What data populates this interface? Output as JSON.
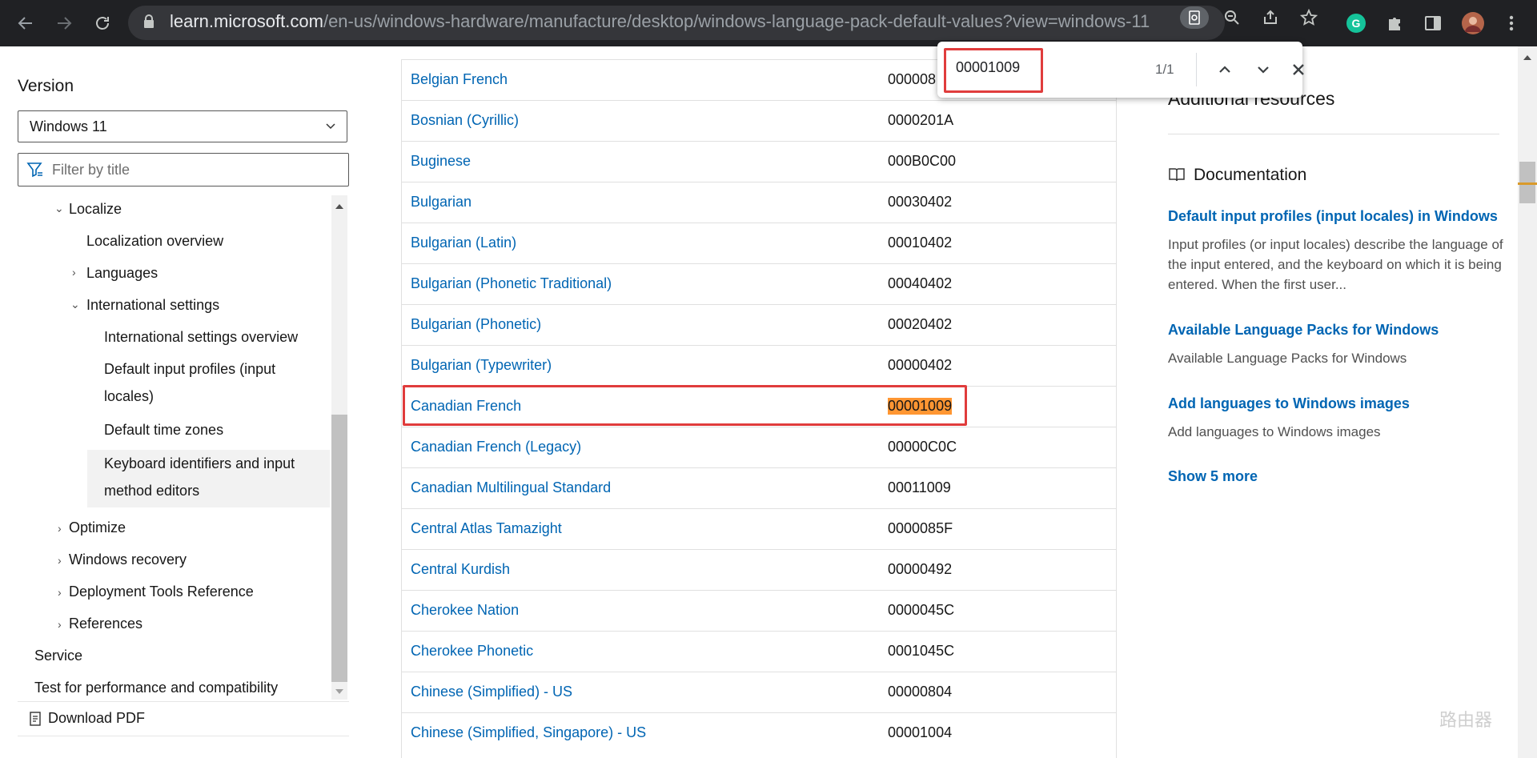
{
  "browser": {
    "url_host": "learn.microsoft.com",
    "url_path": "/en-us/windows-hardware/manufacture/desktop/windows-language-pack-default-values?view=windows-11",
    "find": {
      "query": "00001009",
      "count": "1/1"
    }
  },
  "sidebar": {
    "version_label": "Version",
    "version_value": "Windows 11",
    "filter_placeholder": "Filter by title",
    "items": [
      {
        "label": "Localize"
      },
      {
        "label": "Localization overview"
      },
      {
        "label": "Languages"
      },
      {
        "label": "International settings"
      },
      {
        "label": "International settings overview"
      },
      {
        "label": "Default input profiles (input"
      },
      {
        "label": "locales)"
      },
      {
        "label": "Default time zones"
      },
      {
        "label": "Keyboard identifiers and input"
      },
      {
        "label": "method editors"
      },
      {
        "label": "Optimize"
      },
      {
        "label": "Windows recovery"
      },
      {
        "label": "Deployment Tools Reference"
      },
      {
        "label": "References"
      },
      {
        "label": "Service"
      },
      {
        "label": "Test for performance and compatibility"
      }
    ],
    "download_pdf": "Download PDF"
  },
  "table": {
    "rows": [
      {
        "name": "Belgian French",
        "code": "000008"
      },
      {
        "name": "Bosnian (Cyrillic)",
        "code": "0000201A"
      },
      {
        "name": "Buginese",
        "code": "000B0C00"
      },
      {
        "name": "Bulgarian",
        "code": "00030402"
      },
      {
        "name": "Bulgarian (Latin)",
        "code": "00010402"
      },
      {
        "name": "Bulgarian (Phonetic Traditional)",
        "code": "00040402"
      },
      {
        "name": "Bulgarian (Phonetic)",
        "code": "00020402"
      },
      {
        "name": "Bulgarian (Typewriter)",
        "code": "00000402"
      },
      {
        "name": "Canadian French",
        "code": "00001009"
      },
      {
        "name": "Canadian French (Legacy)",
        "code": "00000C0C"
      },
      {
        "name": "Canadian Multilingual Standard",
        "code": "00011009"
      },
      {
        "name": "Central Atlas Tamazight",
        "code": "0000085F"
      },
      {
        "name": "Central Kurdish",
        "code": "00000492"
      },
      {
        "name": "Cherokee Nation",
        "code": "0000045C"
      },
      {
        "name": "Cherokee Phonetic",
        "code": "0001045C"
      },
      {
        "name": "Chinese (Simplified) - US",
        "code": "00000804"
      },
      {
        "name": "Chinese (Simplified, Singapore) - US",
        "code": "00001004"
      }
    ]
  },
  "right": {
    "additional_resources": "Additional resources",
    "documentation": "Documentation",
    "links": [
      {
        "title": "Default input profiles (input locales) in Windows",
        "desc": "Input profiles (or input locales) describe the language of the input entered, and the keyboard on which it is being entered. When the first user..."
      },
      {
        "title": "Available Language Packs for Windows",
        "desc": "Available Language Packs for Windows"
      },
      {
        "title": "Add languages to Windows images",
        "desc": "Add languages to Windows images"
      }
    ],
    "show_more": "Show 5 more"
  },
  "watermark": "路由器"
}
